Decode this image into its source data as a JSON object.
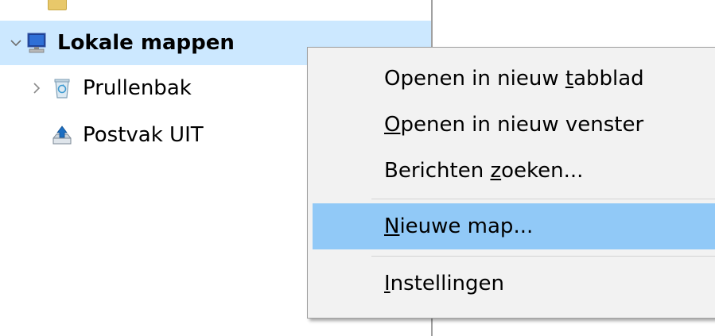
{
  "folder_tree": {
    "items": [
      {
        "label": "Lokale mappen",
        "expanded": true,
        "selected": true,
        "icon": "computer-icon"
      },
      {
        "label": "Prullenbak",
        "expanded": false,
        "selected": false,
        "icon": "recycle-bin-icon"
      },
      {
        "label": "Postvak UIT",
        "expanded": false,
        "selected": false,
        "icon": "outbox-icon"
      }
    ]
  },
  "context_menu": {
    "items": [
      {
        "pre": "Openen in nieuw ",
        "accel": "t",
        "post": "abblad",
        "highlighted": false
      },
      {
        "pre": "",
        "accel": "O",
        "post": "penen in nieuw venster",
        "highlighted": false
      },
      {
        "pre": "Berichten ",
        "accel": "z",
        "post": "oeken...",
        "highlighted": false
      },
      {
        "pre": "",
        "accel": "N",
        "post": "ieuwe map...",
        "highlighted": true
      },
      {
        "pre": "",
        "accel": "I",
        "post": "nstellingen",
        "highlighted": false
      }
    ]
  },
  "colors": {
    "selection": "#cce8ff",
    "menu_highlight": "#91c9f7",
    "menu_background": "#f2f2f2"
  }
}
